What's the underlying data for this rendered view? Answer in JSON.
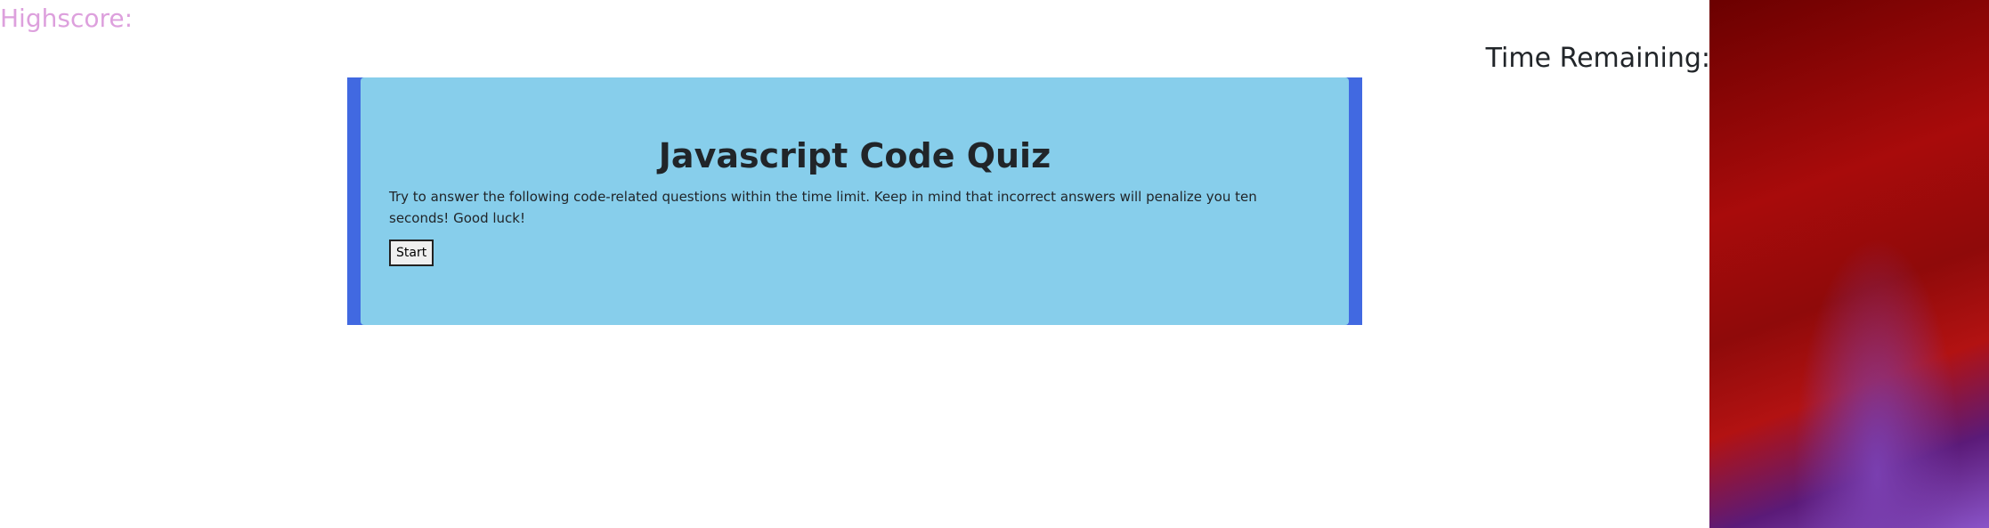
{
  "header": {
    "highscore_label": "Highscore:",
    "timer_label": "Time Remaining:"
  },
  "quiz": {
    "title": "Javascript Code Quiz",
    "description": "Try to answer the following code-related questions within the time limit. Keep in mind that incorrect answers will penalize you ten seconds! Good luck!",
    "start_label": "Start"
  },
  "colors": {
    "highscore_text": "#dda0dd",
    "card_border": "#4169e1",
    "card_background": "#87ceeb"
  }
}
